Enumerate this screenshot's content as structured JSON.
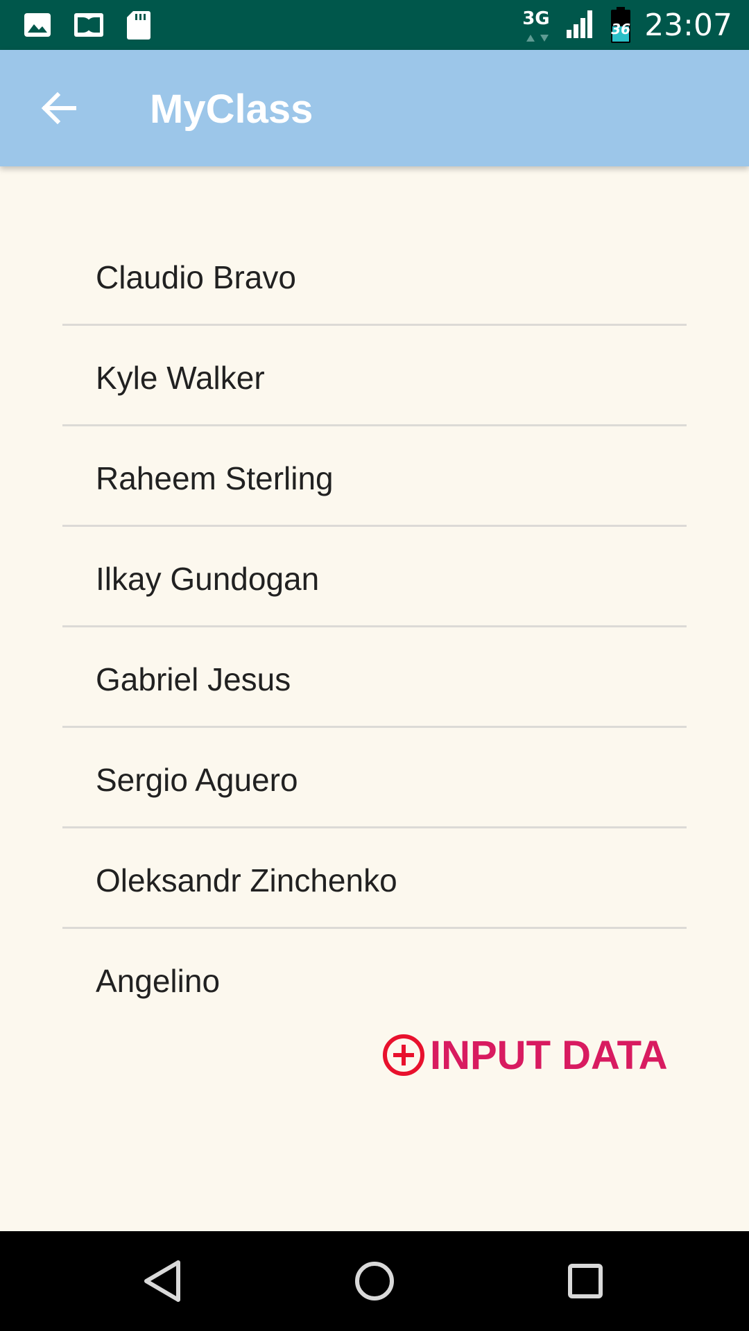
{
  "status_bar": {
    "time": "23:07",
    "network_type": "3G",
    "battery_level": "36",
    "left_icons": [
      "image-icon",
      "dolby-icon",
      "sd-card-icon"
    ],
    "bg_color": "#00574b"
  },
  "app_bar": {
    "title": "MyClass",
    "back_icon": "arrow-back-icon",
    "bg_color": "#9cc6e9"
  },
  "list": {
    "items": [
      {
        "name": "Claudio Bravo"
      },
      {
        "name": "Kyle Walker"
      },
      {
        "name": "Raheem Sterling"
      },
      {
        "name": "Ilkay Gundogan"
      },
      {
        "name": "Gabriel Jesus"
      },
      {
        "name": "Sergio Aguero"
      },
      {
        "name": "Oleksandr Zinchenko"
      },
      {
        "name": "Angelino"
      }
    ]
  },
  "input_button": {
    "label": "INPUT DATA",
    "icon": "add-circle-icon",
    "icon_color": "#e8112d",
    "text_color": "#d81b60"
  },
  "nav_bar": {
    "buttons": [
      "back-triangle-icon",
      "home-circle-icon",
      "recents-square-icon"
    ]
  }
}
